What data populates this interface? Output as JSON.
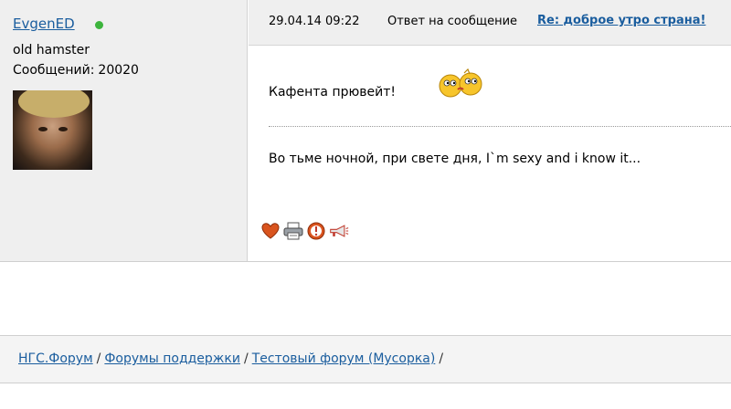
{
  "author": {
    "name": "EvgenED",
    "status": "old hamster",
    "posts_label": "Сообщений:",
    "posts_count": "20020",
    "online_color": "#3db43d"
  },
  "post": {
    "date": "29.04.14 09:22",
    "reply_label": "Ответ на сообщение",
    "reply_link": "Re: доброе утро страна!",
    "line1": "Кафента прювейт!",
    "line2": "Во тьме ночной, при свете дня, I`m sexy and i know it...",
    "actions": [
      "heart-icon",
      "printer-icon",
      "warning-icon",
      "megaphone-icon"
    ]
  },
  "breadcrumb": {
    "items": [
      "НГС.Форум",
      "Форумы поддержки",
      "Тестовый форум (Мусорка)"
    ],
    "separator": "/"
  },
  "colors": {
    "link": "#1a5d9e",
    "panel": "#efefef"
  }
}
